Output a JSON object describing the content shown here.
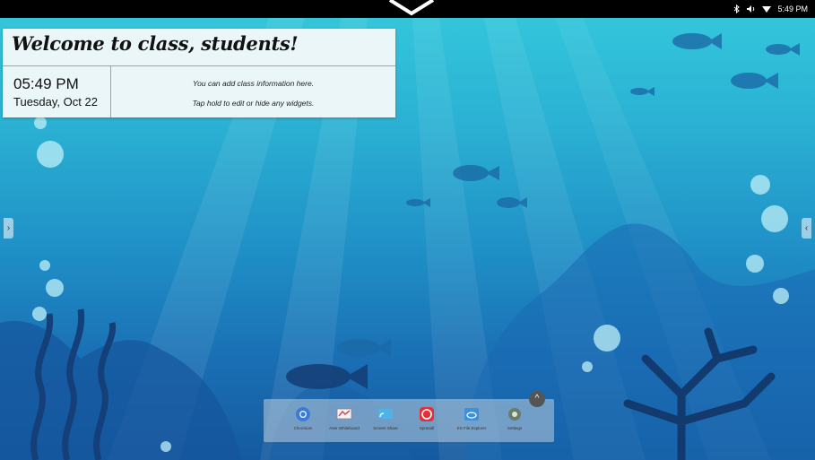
{
  "status_bar": {
    "time": "5:49 PM",
    "icons": [
      "bluetooth-icon",
      "volume-icon",
      "wifi-icon"
    ]
  },
  "widget": {
    "title": "Welcome to class, students!",
    "clock_time": "05:49 PM",
    "clock_date": "Tuesday, Oct 22",
    "info_line1": "You can add class information here.",
    "info_line2": "Tap hold to edit or hide any widgets."
  },
  "side_tabs": {
    "left": "›",
    "right": "‹"
  },
  "dock": {
    "toggle": "^",
    "apps": [
      {
        "label": "Chromium",
        "icon": "chromium-icon",
        "color": "#3a7bd5"
      },
      {
        "label": "AVer Whiteboard",
        "icon": "whiteboard-icon",
        "color": "#d64a5a"
      },
      {
        "label": "Screen Share",
        "icon": "screen-share-icon",
        "color": "#4fb3e8"
      },
      {
        "label": "Sprasall",
        "icon": "sprasall-icon",
        "color": "#e0303a"
      },
      {
        "label": "ES File Explorer",
        "icon": "file-explorer-icon",
        "color": "#3d8fe0"
      },
      {
        "label": "Settings",
        "icon": "settings-icon",
        "color": "#6a7d6a"
      }
    ]
  },
  "colors": {
    "water_top": "#34c9dc",
    "water_bottom": "#155aa0",
    "widget_bg": "#eaf6f8"
  }
}
